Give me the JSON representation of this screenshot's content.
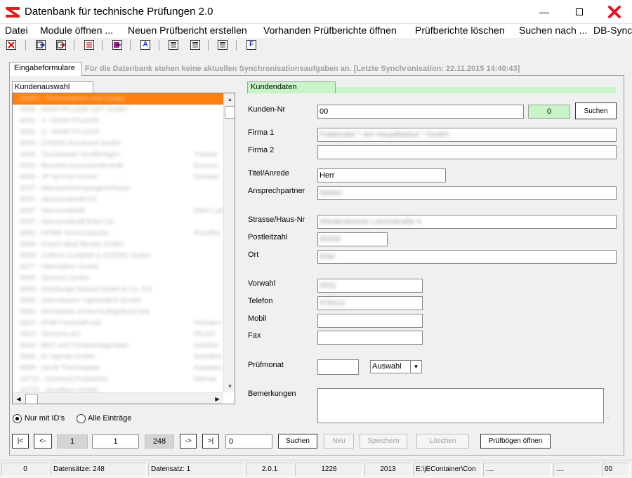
{
  "window": {
    "title": "Datenbank für technische Prüfungen 2.0",
    "icons": {
      "app": "app-logo-icon",
      "minimize": "minimize-icon",
      "maximize": "maximize-icon",
      "close": "close-icon"
    },
    "close_color": "#e81123"
  },
  "menu": {
    "items": [
      {
        "label": "Datei"
      },
      {
        "label": "Module öffnen ..."
      },
      {
        "label": "Neuen Prüfbericht erstellen"
      },
      {
        "label": "Vorhanden Prüfberichte öffnen"
      },
      {
        "label": "Prüfberichte löschen"
      },
      {
        "label": "Suchen nach ..."
      },
      {
        "label": "DB-Sync"
      }
    ]
  },
  "toolbar": {
    "buttons": [
      {
        "icon": "close-red-x-icon",
        "label": ""
      },
      {
        "icon": "export-blue-arrow-icon",
        "label": ""
      },
      {
        "icon": "export-red-arrow-icon",
        "label": ""
      },
      {
        "icon": "report-red-icon",
        "label": ""
      },
      {
        "icon": "export-purple-arrow-icon",
        "label": ""
      },
      {
        "icon": "letter-a-icon",
        "label": "A"
      },
      {
        "icon": "document-lines-icon",
        "label": ""
      },
      {
        "icon": "document-lines-icon",
        "label": ""
      },
      {
        "icon": "document-lines-icon",
        "label": ""
      },
      {
        "icon": "letter-f-icon",
        "label": "F"
      }
    ]
  },
  "tabs": {
    "main_label": "Eingabeformulare",
    "sync_status": "Für die Datenbank stehen keine aktuellen Synchronisationsaufgaben an. [Letzte Synchronisation: 22.11.2015 14:40:43]"
  },
  "customer_list": {
    "tab_label": "Kundenauswahl",
    "rows": [
      {
        "c1": "00003 - Firmennamen und Zusatz",
        "c2": "",
        "selected": true
      },
      {
        "c1": "0000 - KRAFTFLOOR GST GmbH",
        "c2": ""
      },
      {
        "c1": "0001 - 3 - KRAFTFLOOR",
        "c2": ""
      },
      {
        "c1": "0002 - 3 - KRAFTFLOOR",
        "c2": ""
      },
      {
        "c1": "0004 - DYNAN Rundumb GmbH",
        "c2": ""
      },
      {
        "c1": "0008 - Tanzwasser Großfertigen",
        "c2": "Trebew"
      },
      {
        "c1": "0015 - Bereitas Autonotenfechnik",
        "c2": "Essenw"
      },
      {
        "c1": "0036 - JP 3d Print GmbH",
        "c2": "Gelrabe"
      },
      {
        "c1": "0037 - Wasserversorgungsverband",
        "c2": ""
      },
      {
        "c1": "0037 - Vacuumdestill KG",
        "c2": ""
      },
      {
        "c1": "0037 - Vacuumdestill",
        "c2": "Elterl Lad"
      },
      {
        "c1": "0037 - Vacuumdestill Erbrl Ltd",
        "c2": ""
      },
      {
        "c1": "0050 - HPMB Semconductor",
        "c2": "Rundtha"
      },
      {
        "c1": "0058 - Kneisl Ideal Becker GmbH",
        "c2": ""
      },
      {
        "c1": "0059 - Zuffon3 SJABAR & GFEMS GmbH",
        "c2": ""
      },
      {
        "c1": "0077 - Halmatiken GmbH",
        "c2": ""
      },
      {
        "c1": "0080 - Sechtrin GmbH",
        "c2": ""
      },
      {
        "c1": "0083 - Dorsburge Gmesil GmbH & Co. KG",
        "c2": ""
      },
      {
        "c1": "0083 - Dammbaren Ygetrichlich GmbH",
        "c2": ""
      },
      {
        "c1": "0083 - Dmmbiden Verbel Kollaphfund bnk",
        "c2": ""
      },
      {
        "c1": "0915 - KFM Fundstoff und",
        "c2": "Holmann"
      },
      {
        "c1": "0923 - Siemens AG",
        "c2": "PILGR"
      },
      {
        "c1": "0924 - Bleh und Forderanlagenbau",
        "c2": "Gerolbe"
      },
      {
        "c1": "0986 - Kr Spenta GmbH",
        "c2": "Schollele"
      },
      {
        "c1": "0989 - Heckl Thermoplast",
        "c2": "Kandelre"
      },
      {
        "c1": "10712 - Systemd Produktion",
        "c2": "Warnar"
      },
      {
        "c1": "10715 - Seraffeen GmbH",
        "c2": ""
      }
    ],
    "scroll_icons": {
      "up": "arrow-up-icon",
      "down": "arrow-down-icon",
      "left": "arrow-left-icon",
      "right": "arrow-right-icon"
    }
  },
  "filters": {
    "only_ids_label": "Nur mit ID's",
    "all_entries_label": "Alle Einträge",
    "only_ids_checked": true
  },
  "navigation": {
    "first": "|<",
    "prev": "<-",
    "current_display": "1",
    "current_input": "1",
    "total": "248",
    "next": "->",
    "last": ">|",
    "search_input": "0",
    "search_label": "Suchen",
    "new_label": "Neu",
    "save_label": "Speichern",
    "delete_label": "Löschen",
    "open_sheets_label": "Prüfbögen öffnen"
  },
  "customer_form": {
    "tab_label": "Kundendaten",
    "tab_color": "#c8f5c8",
    "labels": {
      "customer_no": "Kunden-Nr",
      "company1": "Firma 1",
      "company2": "Firma 2",
      "title": "Titel/Anrede",
      "contact": "Ansprechpartner",
      "street": "Strasse/Haus-Nr",
      "zip": "Postleitzahl",
      "city": "Ort",
      "area_code": "Vorwahl",
      "phone": "Telefon",
      "mobile": "Mobil",
      "fax": "Fax",
      "test_month": "Prüfmonat",
      "remarks": "Bemerkungen"
    },
    "values": {
      "customer_no": "00",
      "id_count": "0",
      "company1": "Fiskbruder * Am Hauptbarbuf * GmbH",
      "company2": "",
      "title": "Herr",
      "contact": "Weber",
      "street": "Wiederstrasse Lammstraße 4",
      "zip": "90000",
      "city": "Eifel",
      "area_code": "0911",
      "phone": "878113",
      "mobile": "",
      "fax": "",
      "test_month": "",
      "remarks": ""
    },
    "search_label": "Suchen",
    "month_select": "Auswahl",
    "month_arrow_icon": "dropdown-arrow-icon"
  },
  "statusbar": {
    "cells": [
      {
        "text": "0"
      },
      {
        "text": "Datensätze: 248"
      },
      {
        "text": "Datensatz: 1"
      },
      {
        "text": "2.0.1"
      },
      {
        "text": "1226"
      },
      {
        "text": "2013"
      },
      {
        "text": "E:\\jEContainer\\Con"
      },
      {
        "text": "...."
      },
      {
        "text": "...."
      },
      {
        "text": "00"
      }
    ]
  }
}
